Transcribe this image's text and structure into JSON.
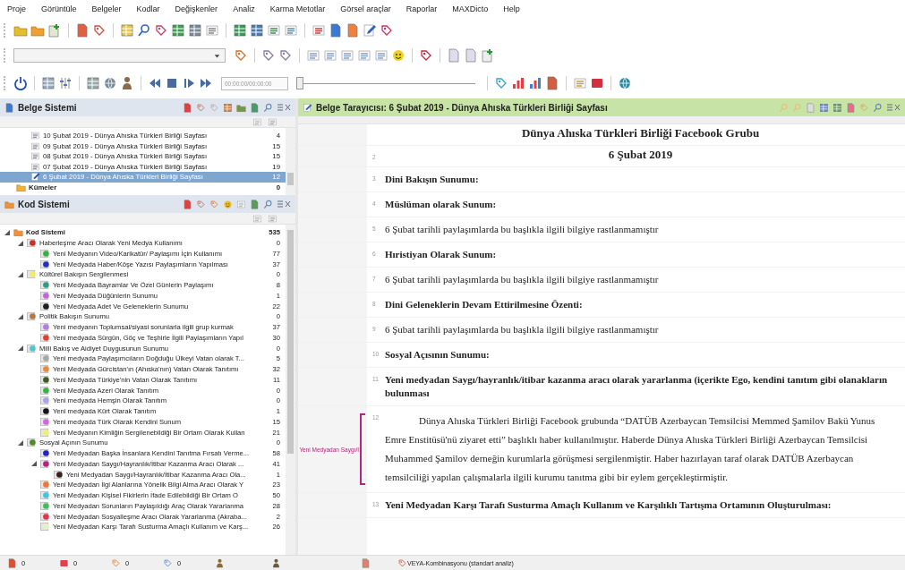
{
  "menu": [
    "Proje",
    "Görüntüle",
    "Belgeler",
    "Kodlar",
    "Değişkenler",
    "Analiz",
    "Karma Metotlar",
    "Görsel araçlar",
    "Raporlar",
    "MAXDicto",
    "Help"
  ],
  "media_bar": {
    "time": "00:00:00/00:00:00",
    "level": 0
  },
  "document_panel": {
    "title": "Belge Sistemi",
    "documents": [
      {
        "name": "10 Şubat 2019 - Dünya Ahıska Türkleri Birliği Sayfası",
        "count": "4",
        "selected": false
      },
      {
        "name": "09 Şubat 2019 - Dünya Ahıska Türkleri Birliği Sayfası",
        "count": "15",
        "selected": false
      },
      {
        "name": "08 Şubat 2019 - Dünya Ahıska Türkleri Birliği Sayfası",
        "count": "15",
        "selected": false
      },
      {
        "name": "07 Şubat 2019 - Dünya Ahıska Türkleri Birliği Sayfası",
        "count": "19",
        "selected": false
      },
      {
        "name": "6 Şubat 2019 - Dünya Ahıska Türkleri Birliği Sayfası",
        "count": "12",
        "selected": true
      }
    ],
    "sets": {
      "name": "Kümeler",
      "count": "0"
    }
  },
  "code_panel": {
    "title": "Kod Sistemi",
    "tree": [
      {
        "name": "Kod Sistemi",
        "count": "535",
        "expanded": true,
        "children": [
          {
            "name": "Haberleşme Aracı Olarak Yeni Medya Kullanımı",
            "count": "0",
            "color": "#d42a2a",
            "expanded": true,
            "children": [
              {
                "name": "Yeni Medyanın Video/Karikatür/ Paylaşımı İçin Kullanımı",
                "count": "77",
                "color": "#3cb043"
              },
              {
                "name": "Yeni Medyada Haber/Köşe Yazısı Paylaşımların Yapılması",
                "count": "37",
                "color": "#2432b8"
              }
            ]
          },
          {
            "name": "Kültürel Bakışın Sergilenmesi",
            "count": "0",
            "color": "#f2ea6a",
            "expanded": true,
            "children": [
              {
                "name": "Yeni Medyada Bayramlar Ve Özel Günlerin Paylaşımı",
                "count": "8",
                "color": "#2f9a85"
              },
              {
                "name": "Yeni Medyada Düğünlerin Sunumu",
                "count": "1",
                "color": "#c066d8"
              },
              {
                "name": "Yeni Medyada Adet Ve Geleneklerin Sunumu",
                "count": "22",
                "color": "#1e1e1e"
              }
            ]
          },
          {
            "name": "Politik Bakışın Sunumu",
            "count": "0",
            "color": "#b8763a",
            "expanded": true,
            "children": [
              {
                "name": "Yeni medyanın Toplumsal/siyasi sorunlarla ilgili grup kurmak",
                "count": "37",
                "color": "#b57ae6"
              },
              {
                "name": "Yeni medyada Sürgün, Göç ve Teşhirle İlgili Paylaşımların Yapıl",
                "count": "30",
                "color": "#e0402e"
              }
            ]
          },
          {
            "name": "Milli Bakış ve Aidiyet Duygusunun Sunumu",
            "count": "0",
            "color": "#4fc6d6",
            "expanded": true,
            "children": [
              {
                "name": "Yeni medyada Paylaşımcıların Doğduğu Ülkeyi Vatan olarak T...",
                "count": "5",
                "color": "#a8a8a8"
              },
              {
                "name": "Yeni Medyada Gürcistan'ın (Ahıska'nın) Vatan Olarak Tanıtımı",
                "count": "32",
                "color": "#e8883a"
              },
              {
                "name": "Yeni Medyada Türkiye'nin Vatan Olarak Tanıtımı",
                "count": "11",
                "color": "#3d5e22"
              },
              {
                "name": "Yeni Medyada Azeri Olarak Tanıtım",
                "count": "0",
                "color": "#3cb043"
              },
              {
                "name": "Yeni medyada Hemşin Olarak Tanıtım",
                "count": "0",
                "color": "#a9a6e6"
              },
              {
                "name": "Yeni medyada Kürt Olarak Tanıtım",
                "count": "1",
                "color": "#151515"
              },
              {
                "name": "Yeni medyada Türk Olarak Kendini Sunum",
                "count": "15",
                "color": "#d068e0"
              },
              {
                "name": "Yeni Medyanın Kimliğin Sergilenebildiği Bir Ortam Olarak Kullan",
                "count": "21",
                "color": "#eef070"
              }
            ]
          },
          {
            "name": "Sosyal Açının Sunumu",
            "count": "0",
            "color": "#4e8a2e",
            "expanded": true,
            "children": [
              {
                "name": "Yeni Medyadan Başka İnsanlara Kendini Tanıtma Fırsatı Verme...",
                "count": "58",
                "color": "#2424c0"
              },
              {
                "name": "Yeni Medyadan Saygı/Hayranlık/İtibar Kazanma Aracı Olarak ...",
                "count": "41",
                "color": "#b0277e",
                "expanded": true,
                "children": [
                  {
                    "name": "Yeni Medyadan Saygı/Hayranlık/İtibar Kazanma Aracı Ola...",
                    "count": "1",
                    "color": "#3a1f1f"
                  }
                ]
              },
              {
                "name": "Yeni Medyadan İlgi Alanlarına Yönelik Bilgi Alma Aracı Olarak Y",
                "count": "23",
                "color": "#f0782e"
              },
              {
                "name": "Yeni Medyadan Kişisel Fikirlerin İfade Edilebildiği Bir Ortam O",
                "count": "50",
                "color": "#45c4e4"
              },
              {
                "name": "Yeni Medyadan Sorunların Paylaşıldığı Araç Olarak Yararlanma",
                "count": "28",
                "color": "#3fbf5a"
              },
              {
                "name": "Yeni Medyadan Sosyalleşme Aracı Olarak Yararlanma (Akraba...",
                "count": "2",
                "color": "#e2344a"
              },
              {
                "name": "Yeni Medyadan Karşı Tarafı Susturma Amaçlı Kullanım ve Karş...",
                "count": "26",
                "color": "#e6f2c4"
              }
            ]
          }
        ]
      }
    ]
  },
  "browser": {
    "title": "Belge Tarayıcısı: 6 Şubat 2019 - Dünya Ahıska Türkleri Birliği Sayfası",
    "paragraphs": [
      {
        "kind": "title",
        "text": "Dünya Ahıska Türkleri Birliği Facebook Grubu"
      },
      {
        "kind": "title",
        "number": "2",
        "text": "6 Şubat 2019"
      },
      {
        "kind": "heading",
        "number": "3",
        "text": "Dini Bakışın Sunumu:"
      },
      {
        "kind": "heading",
        "number": "4",
        "text": "Müslüman olarak Sunum:"
      },
      {
        "kind": "body",
        "number": "5",
        "text": "6 Şubat tarihli paylaşımlarda bu başlıkla ilgili bilgiye rastlanmamıştır"
      },
      {
        "kind": "heading",
        "number": "6",
        "text": "Hıristiyan Olarak Sunum:"
      },
      {
        "kind": "body",
        "number": "7",
        "text": "6 Şubat tarihli paylaşımlarda bu başlıkla ilgili bilgiye rastlanmamıştır"
      },
      {
        "kind": "heading",
        "number": "8",
        "text": "Dini Geleneklerin Devam Ettirilmesine Özenti:"
      },
      {
        "kind": "body",
        "number": "9",
        "text": "6 Şubat tarihli paylaşımlarda bu başlıkla ilgili bilgiye rastlanmamıştır"
      },
      {
        "kind": "heading",
        "number": "10",
        "text": "Sosyal Açısının Sunumu:"
      },
      {
        "kind": "heading",
        "number": "11",
        "text": "Yeni medyadan Saygı/hayranlık/itibar kazanma aracı olarak yararlanma (içerikte Ego, kendini tanıtım gibi olanakların bulunması"
      },
      {
        "kind": "indented",
        "number": "12",
        "text": "Dünya Ahıska Türkleri Birliği Facebook grubunda “DATÜB Azerbaycan Temsilcisi Memmed Şamilov Bakü Yunus Emre Enstitüsü'nü ziyaret etti” başlıklı haber kullanılmıştır. Haberde Dünya Ahıska Türkleri Birliği Azerbaycan Temsilcisi Muhammed Şamilov derneğin kurumlarla görüşmesi sergilenmiştir. Haber hazırlayan taraf olarak DATÜB Azerbaycan temsilciliği yapılan çalışmalarla ilgili kurumu tanıtma gibi bir eylem gerçekleştirmiştir.",
        "coding": {
          "label": "Yeni Medyadan Saygı/I",
          "color": "#b0277e"
        }
      },
      {
        "kind": "heading",
        "number": "13",
        "text": "Yeni Medyadan Karşı Tarafı Susturma Amaçlı Kullanım ve Karşılıklı Tartışma Ortamının Oluşturulması:"
      }
    ]
  },
  "status_bar": {
    "counters": [
      "0",
      "0",
      "0",
      "0"
    ],
    "analysis": "VEYA-Kombinasyonu (standart analiz)"
  }
}
